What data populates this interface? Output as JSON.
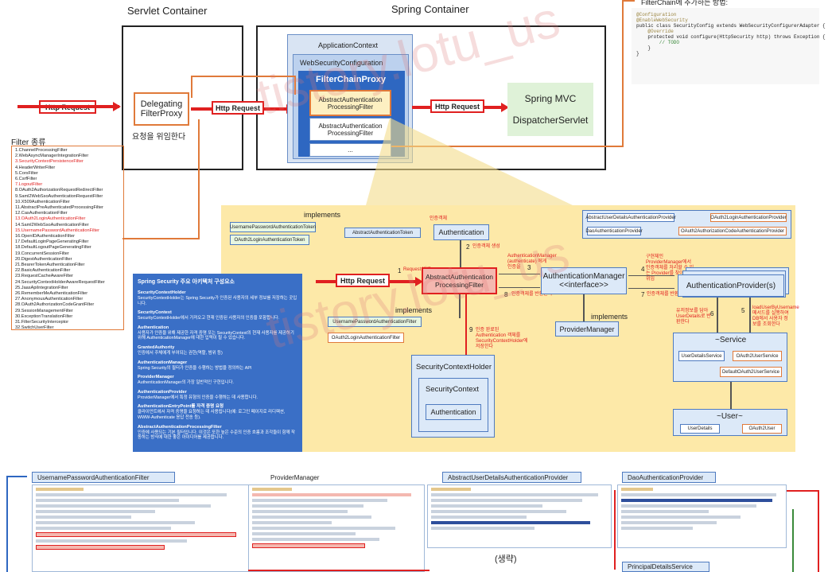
{
  "top": {
    "servlet_container": "Servlet Container",
    "spring_container": "Spring Container",
    "filterchain_note_title": "FilterChain에 추가하는 방법:",
    "http_request_1": "Http Request",
    "http_request_2": "Http Request",
    "http_request_3": "Http Request",
    "delegating_line1": "Delegating",
    "delegating_line2": "FilterProxy",
    "delegating_caption": "요청을 위임한다",
    "application_context": "ApplicationContext",
    "web_security_configuration": "WebSecurityConfiguration",
    "filter_chain_proxy": "FilterChainProxy",
    "auth_filter_1_line1": "AbstractAuthentication",
    "auth_filter_1_line2": "ProcessingFilter",
    "auth_filter_2_line1": "AbstractAuthentication",
    "auth_filter_2_line2": "ProcessingFilter",
    "ellipsis": "...",
    "spring_mvc": "Spring MVC",
    "dispatcher_servlet": "DispatcherServlet",
    "code": [
      "@Configuration",
      "@EnableWebSecurity",
      "public class SecurityConfig extends WebSecurityConfigurerAdapter {",
      "    @Override",
      "    protected void configure(HttpSecurity http) throws Exception {",
      "        // TODO",
      "    }",
      "}"
    ]
  },
  "filters": {
    "title": "Filter 종류",
    "items": [
      {
        "text": "1.ChannelProcessingFilter",
        "red": false
      },
      {
        "text": "2.WebAsyncManagerIntegrationFilter",
        "red": false
      },
      {
        "text": "3.SecurityContextPersistenceFilter",
        "red": true
      },
      {
        "text": "4.HeaderWriterFilter",
        "red": false
      },
      {
        "text": "5.CorsFilter",
        "red": false
      },
      {
        "text": "6.CsrfFilter",
        "red": false
      },
      {
        "text": "7.LogoutFilter",
        "red": true
      },
      {
        "text": "8.OAuth2AuthorizationRequestRedirectFilter",
        "red": false
      },
      {
        "text": "9.Saml2WebSsoAuthenticationRequestFilter",
        "red": false
      },
      {
        "text": "10.X509AuthenticationFilter",
        "red": false
      },
      {
        "text": "11.AbstractPreAuthenticatedProcessingFilter",
        "red": false
      },
      {
        "text": "12.CasAuthenticationFilter",
        "red": false
      },
      {
        "text": "13.OAuth2LoginAuthenticationFilter",
        "red": true
      },
      {
        "text": "14.Saml2WebSsoAuthenticationFilter",
        "red": false
      },
      {
        "text": "15.UsernamePasswordAuthenticationFilter",
        "red": true
      },
      {
        "text": "16.OpenIDAuthenticationFilter",
        "red": false
      },
      {
        "text": "17.DefaultLoginPageGeneratingFilter",
        "red": false
      },
      {
        "text": "18.DefaultLogoutPageGeneratingFilter",
        "red": false
      },
      {
        "text": "19.ConcurrentSessionFilter",
        "red": false
      },
      {
        "text": "20.DigestAuthenticationFilter",
        "red": false
      },
      {
        "text": "21.BearerTokenAuthenticationFilter",
        "red": false
      },
      {
        "text": "22.BasicAuthenticationFilter",
        "red": false
      },
      {
        "text": "23.RequestCacheAwareFilter",
        "red": false
      },
      {
        "text": "24.SecurityContextHolderAwareRequestFilter",
        "red": false
      },
      {
        "text": "25.JaasApiIntegrationFilter",
        "red": false
      },
      {
        "text": "26.RememberMeAuthenticationFilter",
        "red": false
      },
      {
        "text": "27.AnonymousAuthenticationFilter",
        "red": false
      },
      {
        "text": "28.OAuth2AuthorizationCodeGrantFilter",
        "red": false
      },
      {
        "text": "29.SessionManagementFilter",
        "red": false
      },
      {
        "text": "30.ExceptionTranslationFilter",
        "red": false
      },
      {
        "text": "31.FilterSecurityInterceptor",
        "red": false
      },
      {
        "text": "32.SwitchUserFilter",
        "red": false
      }
    ]
  },
  "mid": {
    "implements_1": "implements",
    "implements_2": "implements",
    "implements_3": "implements",
    "up_token": "UsernamePasswordAuthenticationToken",
    "oauth2_token": "OAuth2LoginAuthenticationToken",
    "abstract_auth_token": "AbstractAuthenticationToken",
    "authentication": "Authentication",
    "auth_note": "인증객체",
    "http_request": "Http Request",
    "step1": "1",
    "step1_note": "Request 받고",
    "step2": "2",
    "step2_note": "인증객체 생성",
    "step3": "3",
    "step3_note": "AuthenticationManager (authenticate) 에게 인증을",
    "step4": "4",
    "step4_note": "구현체인 ProviderManager에서 인증객체를 처리할 수 있는 Provider를 찾아 인증위임",
    "step5": "5",
    "step5_note": "loadUserByUsername 메서드를 실행하여 DB에서 사용자 정보를 조회한다",
    "step6": "6",
    "step6_note": "유저정보를 담아 UserDetails로 반환한다",
    "step7": "7",
    "step7_note": "인증객체를 반환한다",
    "step8": "8",
    "step8_note": "인증객체를 반환한다",
    "step9": "9",
    "step9_note": "인증 완료된 Authentication 객체를 SecurityContextHolder에 저장한다",
    "aap_filter_line1": "AbstractAuthentication",
    "aap_filter_line2": "ProcessingFilter",
    "auth_manager_line1": "AuthenticationManager",
    "auth_manager_line2": "<<interface>>",
    "provider_manager": "ProviderManager",
    "up_filter": "UsernamePasswordAuthenticationFilter",
    "oauth2_filter": "OAuth2LoginAuthenticationFilter",
    "sch": "SecurityContextHolder",
    "sc": "SecurityContext",
    "sch_auth": "Authentication",
    "abstract_user_details_provider": "AbstractUserDetailsAuthenticationProvider",
    "dao_provider": "DaoAuthenticationProvider",
    "oauth2_login_provider": "OAuth2LoginAuthenticationProvider",
    "oauth2_code_provider": "OAuth2AuthorizationCodeAuthenticationProvider",
    "auth_providers": "AuthenticationProvider(s)",
    "service": "~Service",
    "user_details_service": "UserDetailsService",
    "oauth2_user_service": "OAuth2UserService",
    "default_oauth2_user_service": "DefaultOAuth2UserService",
    "user": "~User~",
    "user_details": "UserDetails",
    "oauth2_user": "OAuth2User"
  },
  "info": {
    "title": "Spring Security 주요 아키텍처 구성요소",
    "sections": [
      {
        "head": "SecurityContextHolder",
        "body": "SecurityContextHolder는 Spring Security가 인증된 사용자의 세부 정보를 저장하는 곳입니다."
      },
      {
        "head": "SecurityContext",
        "body": "SecurityContextHolder에서 가져오고 현재 인증된 사용자의 인증을 포함합니다."
      },
      {
        "head": "Authentication",
        "body": "사용자가 인증을 위해 제공한 자격 증명 또는 SecurityContext의 현재 사용자를 제공하기 위해 AuthenticationManager에 대한 입력이 될 수 있습니다."
      },
      {
        "head": "GrantedAuthority",
        "body": "인증에서 주체에게 부여되는 권한(역할, 범위 등)"
      },
      {
        "head": "AuthenticationManager",
        "body": "Spring Security의 필터가 인증을 수행하는 방법을 정의하는 API"
      },
      {
        "head": "ProviderManager",
        "body": "AuthenticationManager의 가장 일반적인 구현입니다."
      },
      {
        "head": "AuthenticationProvider",
        "body": "ProviderManager에서 특정 유형의 인증을 수행하는 데 사용합니다."
      },
      {
        "head": "AuthenticationEntryPoint를 자격 증명 요청",
        "body": "클라이언트에서 자격 증명을 요청하는 데 사용됩니다(예: 로그인 페이지로 리디렉션, WWW-Authenticate 응답 전송 등)."
      },
      {
        "head": "AbstractAuthenticationProcessingFilter",
        "body": "인증에 사용되는 기본 필터입니다. 이것은 또한 높은 수준의 인증 흐름과 조각들이 함께 작동하는 방식에 대한 좋은 아이디어를 제공합니다."
      }
    ]
  },
  "bottom": {
    "panel1": "UsernamePasswordAuthenticationFilter",
    "panel2": "ProviderManager",
    "panel3": "AbstractUserDetailsAuthenticationProvider",
    "panel4": "DaoAuthenticationProvider",
    "panel5": "PrincipalDetailsService",
    "omitted": "(생략)"
  },
  "watermark": [
    "tistory.lotu_us",
    "tistory.lotu_us",
    "tistory.lotu_us"
  ],
  "colors": {
    "red_accent": "#e02020",
    "orange_arrow": "#e07a3a",
    "yellow_area": "#fde9a8",
    "fcp_blue": "#2e67c1",
    "info_blue": "#3a6fc6",
    "mvc_green": "#dff2d8",
    "light_blue_box": "#dce9f8"
  }
}
